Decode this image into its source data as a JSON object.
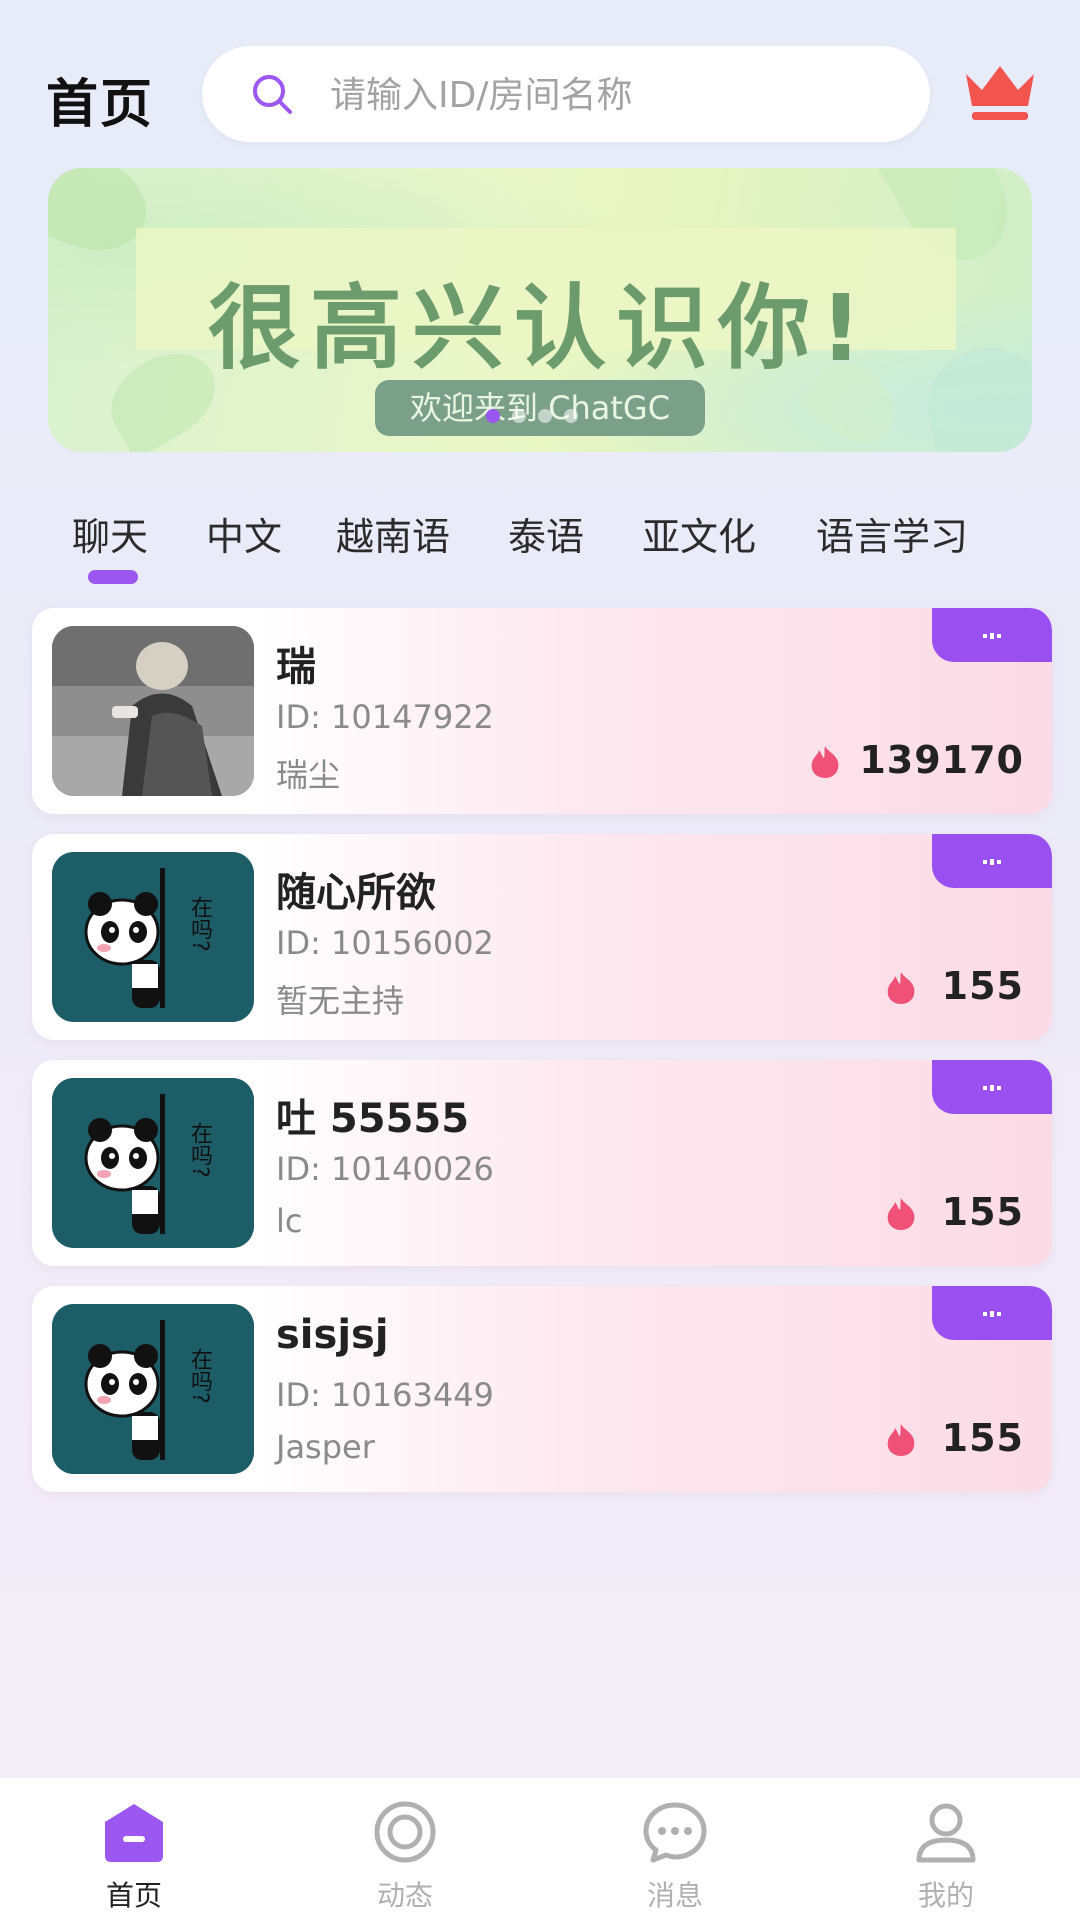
{
  "header": {
    "title": "首页",
    "search_placeholder": "请输入ID/房间名称",
    "vip_icon": "crown-icon",
    "accent_color": "#f2554e"
  },
  "banner": {
    "headline": "很高兴认识你!",
    "subtitle": "欢迎来到 ChatGC",
    "slides": 4,
    "active_slide": 1
  },
  "tabs": [
    {
      "label": "聊天",
      "active": true
    },
    {
      "label": "中文",
      "active": false
    },
    {
      "label": "越南语",
      "active": false
    },
    {
      "label": "泰语",
      "active": false
    },
    {
      "label": "亚文化",
      "active": false
    },
    {
      "label": "语言学习",
      "active": false
    }
  ],
  "rooms": [
    {
      "name": "瑞",
      "id": "ID: 10147922",
      "host": "瑞尘",
      "heat": "139170",
      "avatar": "photo-avatar"
    },
    {
      "name": "随心所欲",
      "id": "ID: 10156002",
      "host": "暂无主持",
      "heat": "155",
      "avatar": "panda-avatar"
    },
    {
      "name": "吐 55555",
      "id": "ID: 10140026",
      "host": "lc",
      "heat": "155",
      "avatar": "panda-avatar"
    },
    {
      "name": "sisjsj",
      "id": "ID: 10163449",
      "host": "Jasper",
      "heat": "155",
      "avatar": "panda-avatar"
    }
  ],
  "panda_avatar_text": "在吗?",
  "nav": [
    {
      "label": "首页",
      "icon": "home-icon",
      "active": true
    },
    {
      "label": "动态",
      "icon": "feed-icon",
      "active": false
    },
    {
      "label": "消息",
      "icon": "message-icon",
      "active": false
    },
    {
      "label": "我的",
      "icon": "profile-icon",
      "active": false
    }
  ],
  "colors": {
    "primary": "#9a4ff0",
    "heat": "#f05277",
    "card_gradient_end": "#fbdbe6"
  }
}
